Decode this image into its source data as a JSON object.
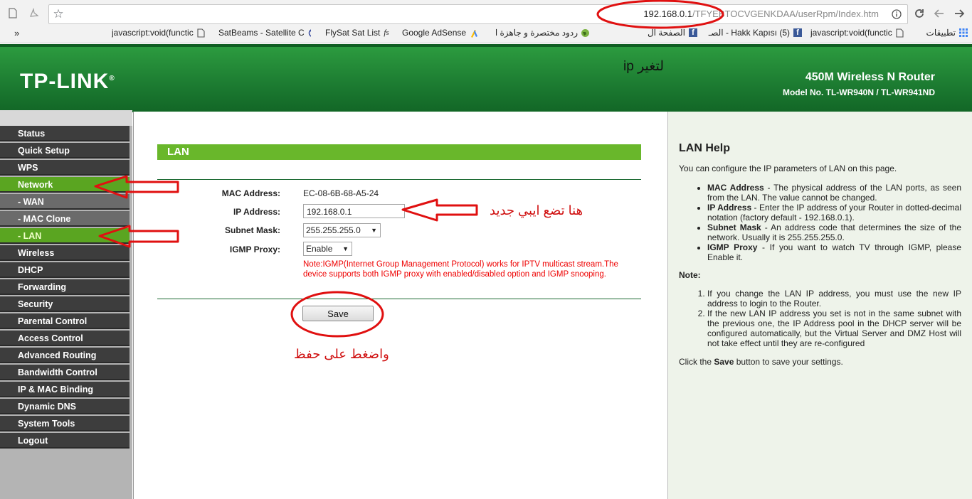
{
  "browser": {
    "url_host": "192.168.0.1",
    "url_path": "/TFYEBTOCVGENKDAA/userRpm/Index.htm",
    "bookmarks": [
      {
        "label": "javascript:void(functic",
        "icon": "page-icon"
      },
      {
        "label": "SatBeams - Satellite C",
        "icon": "satbeams-icon"
      },
      {
        "label": "FlySat Sat List",
        "icon": "fs-icon"
      },
      {
        "label": "Google AdSense",
        "icon": "adsense-icon"
      },
      {
        "label": "ردود مختصرة و جاهزة ا",
        "icon": "globe-icon"
      },
      {
        "label": "الصفحة ال",
        "icon": "facebook-icon"
      },
      {
        "label": "Hakk Kapısı (5) - الصـ",
        "icon": "facebook-icon"
      },
      {
        "label": "javascript:void(functic",
        "icon": "page-icon"
      },
      {
        "label": "تطبيقات",
        "icon": "apps-icon"
      }
    ],
    "overflow_label": "»"
  },
  "header": {
    "logo": "TP-LINK",
    "logo_mark": "®",
    "product": "450M Wireless N Router",
    "model": "Model No. TL-WR940N / TL-WR941ND",
    "annotation": "لتغير ip"
  },
  "menu": {
    "items": [
      {
        "label": "Status"
      },
      {
        "label": "Quick Setup"
      },
      {
        "label": "WPS"
      },
      {
        "label": "Network"
      },
      {
        "label": "- WAN"
      },
      {
        "label": "- MAC Clone"
      },
      {
        "label": "- LAN"
      },
      {
        "label": "Wireless"
      },
      {
        "label": "DHCP"
      },
      {
        "label": "Forwarding"
      },
      {
        "label": "Security"
      },
      {
        "label": "Parental Control"
      },
      {
        "label": "Access Control"
      },
      {
        "label": "Advanced Routing"
      },
      {
        "label": "Bandwidth Control"
      },
      {
        "label": "IP & MAC Binding"
      },
      {
        "label": "Dynamic DNS"
      },
      {
        "label": "System Tools"
      },
      {
        "label": "Logout"
      }
    ]
  },
  "lan": {
    "title": "LAN",
    "mac_label": "MAC Address:",
    "mac_value": "EC-08-6B-68-A5-24",
    "ip_label": "IP Address:",
    "ip_value": "192.168.0.1",
    "mask_label": "Subnet Mask:",
    "mask_value": "255.255.255.0",
    "igmp_label": "IGMP Proxy:",
    "igmp_value": "Enable",
    "note": "Note:IGMP(Internet Group Management Protocol) works for IPTV multicast stream.The device supports both IGMP proxy with enabled/disabled option and IGMP snooping.",
    "save_label": "Save",
    "annot_ip": "هنا تضع ايبي جديد",
    "annot_save": "واضغط على حفظ"
  },
  "help": {
    "title": "LAN Help",
    "intro": "You can configure the IP parameters of LAN on this page.",
    "items": [
      {
        "term": "MAC Address",
        "text": " - The physical address of the LAN ports, as seen from the LAN. The value cannot be changed."
      },
      {
        "term": "IP Address",
        "text": " - Enter the IP address of your Router in dotted-decimal notation (factory default - 192.168.0.1)."
      },
      {
        "term": "Subnet Mask",
        "text": " - An address code that determines the size of the network. Usually it is 255.255.255.0."
      },
      {
        "term": "IGMP Proxy",
        "text": " - If you want to watch TV through IGMP, please Enable it."
      }
    ],
    "note_heading": "Note:",
    "notes": [
      "If you change the LAN IP address, you must use the new IP address to login to the Router.",
      "If the new LAN IP address you set is not in the same subnet with the previous one, the IP Address pool in the DHCP server will be configured automatically, but the Virtual Server and DMZ Host will not take effect until they are re-configured"
    ],
    "footer_pre": "Click the ",
    "footer_bold": "Save",
    "footer_post": " button to save your settings."
  },
  "colors": {
    "header_green": "#1d7d32",
    "active_menu": "#5aa521",
    "title_bar": "#69b72b",
    "annotation_red": "#d01010"
  }
}
